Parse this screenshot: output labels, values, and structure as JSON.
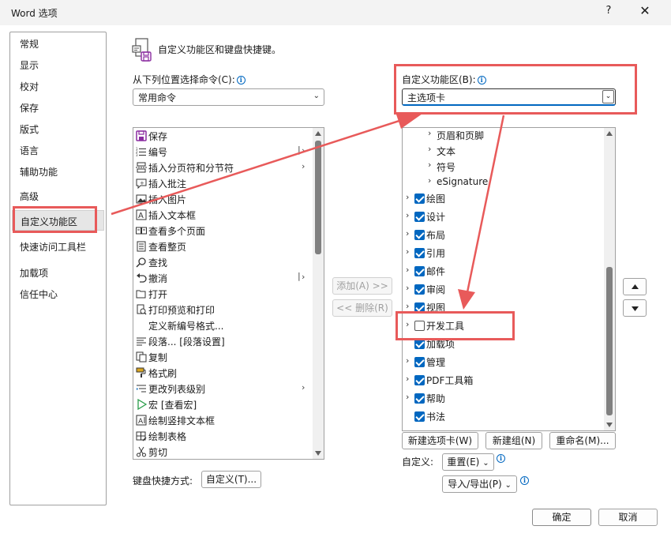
{
  "window": {
    "title": "Word 选项",
    "help_label": "?",
    "close_label": "✕"
  },
  "nav": {
    "items": [
      {
        "label": "常规"
      },
      {
        "label": "显示"
      },
      {
        "label": "校对"
      },
      {
        "label": "保存"
      },
      {
        "label": "版式"
      },
      {
        "label": "语言"
      },
      {
        "label": "辅助功能"
      },
      {
        "label": "高级"
      },
      {
        "label": "自定义功能区",
        "selected": true
      },
      {
        "label": "快速访问工具栏"
      },
      {
        "label": "加载项"
      },
      {
        "label": "信任中心"
      }
    ]
  },
  "header": {
    "title": "自定义功能区和键盘快捷键。",
    "icon": "customize-ribbon-icon"
  },
  "left": {
    "choose_label": "从下列位置选择命令(C):",
    "choose_value": "常用命令",
    "commands": [
      {
        "label": "保存",
        "icon": "save-icon",
        "color": "#8a2ba0"
      },
      {
        "label": "编号",
        "icon": "numbering-icon",
        "separator": true
      },
      {
        "label": "插入分页符和分节符",
        "icon": "page-break-icon",
        "submenu": true
      },
      {
        "label": "插入批注",
        "icon": "comment-icon"
      },
      {
        "label": "插入图片",
        "icon": "picture-icon"
      },
      {
        "label": "插入文本框",
        "icon": "textbox-icon"
      },
      {
        "label": "查看多个页面",
        "icon": "multi-page-icon"
      },
      {
        "label": "查看整页",
        "icon": "one-page-icon"
      },
      {
        "label": "查找",
        "icon": "find-icon"
      },
      {
        "label": "撤消",
        "icon": "undo-icon",
        "separator": true
      },
      {
        "label": "打开",
        "icon": "open-icon"
      },
      {
        "label": "打印预览和打印",
        "icon": "print-preview-icon"
      },
      {
        "label": "定义新编号格式...",
        "icon": ""
      },
      {
        "label": "段落... [段落设置]",
        "icon": "paragraph-icon"
      },
      {
        "label": "复制",
        "icon": "copy-icon"
      },
      {
        "label": "格式刷",
        "icon": "format-painter-icon"
      },
      {
        "label": "更改列表级别",
        "icon": "list-level-icon",
        "submenu": true
      },
      {
        "label": "宏 [查看宏]",
        "icon": "macro-icon"
      },
      {
        "label": "绘制竖排文本框",
        "icon": "vertical-textbox-icon"
      },
      {
        "label": "绘制表格",
        "icon": "draw-table-icon"
      },
      {
        "label": "剪切",
        "icon": "cut-icon"
      }
    ],
    "shortcut_label": "键盘快捷方式:",
    "shortcut_button": "自定义(T)..."
  },
  "middle": {
    "add_label": "添加(A) >>",
    "remove_label": "<< 删除(R)"
  },
  "right": {
    "ribbon_label": "自定义功能区(B):",
    "ribbon_value": "主选项卡",
    "tree": [
      {
        "label": "页眉和页脚",
        "level": 2
      },
      {
        "label": "文本",
        "level": 2
      },
      {
        "label": "符号",
        "level": 2
      },
      {
        "label": "eSignature",
        "level": 2
      },
      {
        "label": "绘图",
        "level": 1,
        "checked": true
      },
      {
        "label": "设计",
        "level": 1,
        "checked": true
      },
      {
        "label": "布局",
        "level": 1,
        "checked": true
      },
      {
        "label": "引用",
        "level": 1,
        "checked": true
      },
      {
        "label": "邮件",
        "level": 1,
        "checked": true
      },
      {
        "label": "审阅",
        "level": 1,
        "checked": true
      },
      {
        "label": "视图",
        "level": 1,
        "checked": true
      },
      {
        "label": "开发工具",
        "level": 1,
        "checked": false
      },
      {
        "label": "加载项",
        "level": 1,
        "checked": true,
        "no_expander": true
      },
      {
        "label": "管理",
        "level": 1,
        "checked": true
      },
      {
        "label": "PDF工具箱",
        "level": 1,
        "checked": true
      },
      {
        "label": "帮助",
        "level": 1,
        "checked": true
      },
      {
        "label": "书法",
        "level": 1,
        "checked": true,
        "no_expander": true
      }
    ],
    "new_tab_button": "新建选项卡(W)",
    "new_group_button": "新建组(N)",
    "rename_button": "重命名(M)...",
    "customize_label": "自定义:",
    "reset_button": "重置(E)",
    "import_export_button": "导入/导出(P)",
    "move_up_icon": "triangle-up-icon",
    "move_down_icon": "triangle-down-icon"
  },
  "footer": {
    "ok_label": "确定",
    "cancel_label": "取消"
  },
  "colors": {
    "accent": "#0067c0",
    "annotation": "#e85a5a"
  }
}
